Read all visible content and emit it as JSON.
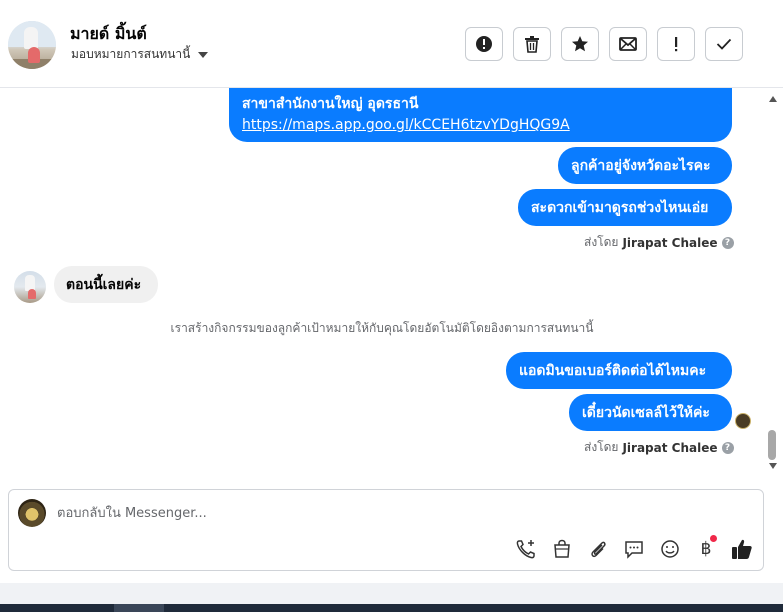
{
  "header": {
    "contact_name": "มายด์ มิ้นต์",
    "assign_label": "มอบหมายการสนทนานี้",
    "tools": [
      {
        "name": "alert-button",
        "icon": "alert-circle-icon"
      },
      {
        "name": "delete-button",
        "icon": "trash-icon"
      },
      {
        "name": "star-button",
        "icon": "star-icon"
      },
      {
        "name": "mark-unread-button",
        "icon": "envelope-icon"
      },
      {
        "name": "follow-up-button",
        "icon": "exclamation-icon"
      },
      {
        "name": "done-button",
        "icon": "check-icon"
      }
    ]
  },
  "messages": {
    "m1_line1": "สาขาสำนักงานใหญ่ อุดรธานี",
    "m1_link": "https://maps.app.goo.gl/kCCEH6tzvYDgHQG9A",
    "m2": "ลูกค้าอยู่จังหวัดอะไรคะ",
    "m3": "สะดวกเข้ามาดูรถช่วงไหนเอ่ย",
    "sent_by_prefix_1": "ส่งโดย",
    "sent_by_name_1": "Jirapat Chalee",
    "incoming_1": "ตอนนี้เลยค่ะ",
    "system_note": "เราสร้างกิจกรรมของลูกค้าเป้าหมายให้กับคุณโดยอัตโนมัติโดยอิงตามการสนทนานี้",
    "m4": "แอดมินขอเบอร์ติดต่อได้ไหมคะ",
    "m5": "เดี๋ยวนัดเซลล์ไว้ให้ค่ะ",
    "sent_by_prefix_2": "ส่งโดย",
    "sent_by_name_2": "Jirapat Chalee",
    "help_glyph": "?"
  },
  "composer": {
    "placeholder": "ตอบกลับใน Messenger...",
    "icons": [
      "call-add-icon",
      "shopping-bag-icon",
      "paperclip-icon",
      "chat-bubble-icon",
      "emoji-icon",
      "baht-icon",
      "thumbs-up-icon"
    ],
    "baht_glyph": "฿",
    "accent_color": "#0a7cff",
    "badge_color": "#f02849"
  }
}
